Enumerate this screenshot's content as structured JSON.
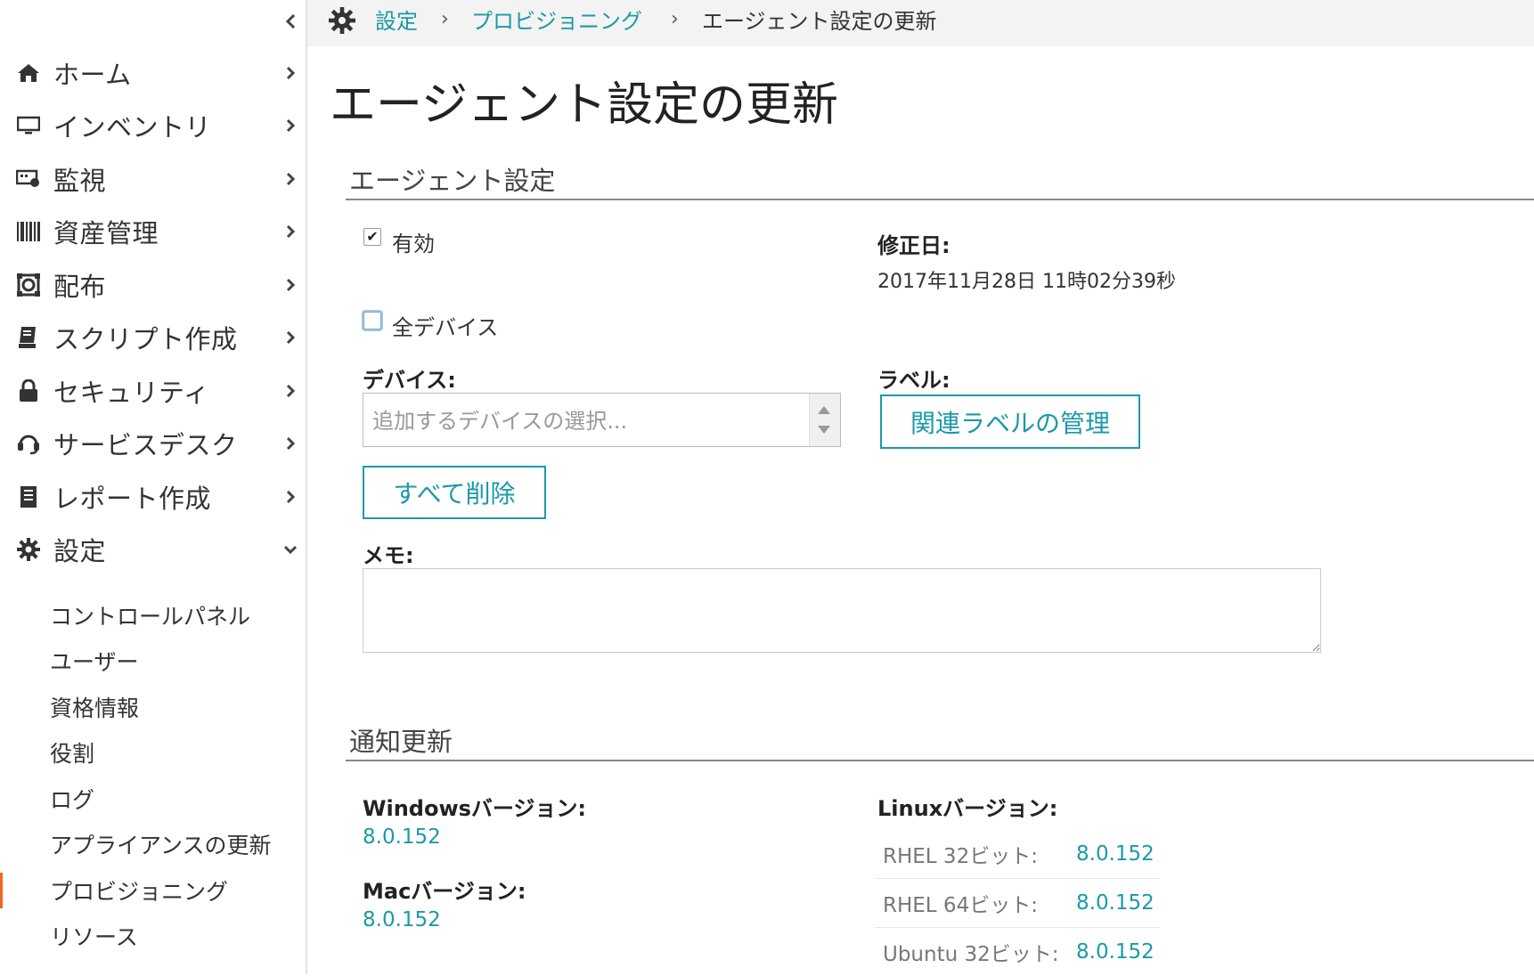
{
  "sidebar": {
    "items": [
      {
        "label": "ホーム",
        "icon": "home-icon"
      },
      {
        "label": "インベントリ",
        "icon": "monitor-icon"
      },
      {
        "label": "監視",
        "icon": "monitoring-icon"
      },
      {
        "label": "資産管理",
        "icon": "barcode-icon"
      },
      {
        "label": "配布",
        "icon": "distribution-icon"
      },
      {
        "label": "スクリプト作成",
        "icon": "script-icon"
      },
      {
        "label": "セキュリティ",
        "icon": "lock-icon"
      },
      {
        "label": "サービスデスク",
        "icon": "headset-icon"
      },
      {
        "label": "レポート作成",
        "icon": "report-icon"
      },
      {
        "label": "設定",
        "icon": "gear-icon"
      }
    ],
    "subitems": [
      {
        "label": "コントロールパネル"
      },
      {
        "label": "ユーザー"
      },
      {
        "label": "資格情報"
      },
      {
        "label": "役割"
      },
      {
        "label": "ログ"
      },
      {
        "label": "アプライアンスの更新"
      },
      {
        "label": "プロビジョニング",
        "active": true
      },
      {
        "label": "リソース"
      }
    ]
  },
  "breadcrumb": {
    "items": [
      "設定",
      "プロビジョニング",
      "エージェント設定の更新"
    ],
    "separator": "›"
  },
  "page": {
    "title": "エージェント設定の更新"
  },
  "agent_settings": {
    "section_title": "エージェント設定",
    "enabled": {
      "label": "有効",
      "checked": true,
      "mark": "✔"
    },
    "modified": {
      "label": "修正日:",
      "value": "2017年11月28日 11時02分39秒"
    },
    "all_devices": {
      "label": "全デバイス",
      "checked": false
    },
    "devices": {
      "label": "デバイス:",
      "placeholder": "追加するデバイスの選択..."
    },
    "labels": {
      "label": "ラベル:",
      "button": "関連ラベルの管理"
    },
    "remove_all_button": "すべて削除",
    "memo": {
      "label": "メモ:",
      "value": ""
    }
  },
  "notification_update": {
    "section_title": "通知更新",
    "windows": {
      "label": "Windowsバージョン:",
      "value": "8.0.152"
    },
    "mac": {
      "label": "Macバージョン:",
      "value": "8.0.152"
    },
    "linux": {
      "label": "Linuxバージョン:",
      "rows": [
        {
          "name": "RHEL 32ビット:",
          "value": "8.0.152"
        },
        {
          "name": "RHEL 64ビット:",
          "value": "8.0.152"
        },
        {
          "name": "Ubuntu 32ビット:",
          "value": "8.0.152"
        }
      ]
    }
  },
  "colors": {
    "accent": "#1a9aa8",
    "active_marker": "#f26522",
    "topbar_bg": "#f3f3f3"
  }
}
